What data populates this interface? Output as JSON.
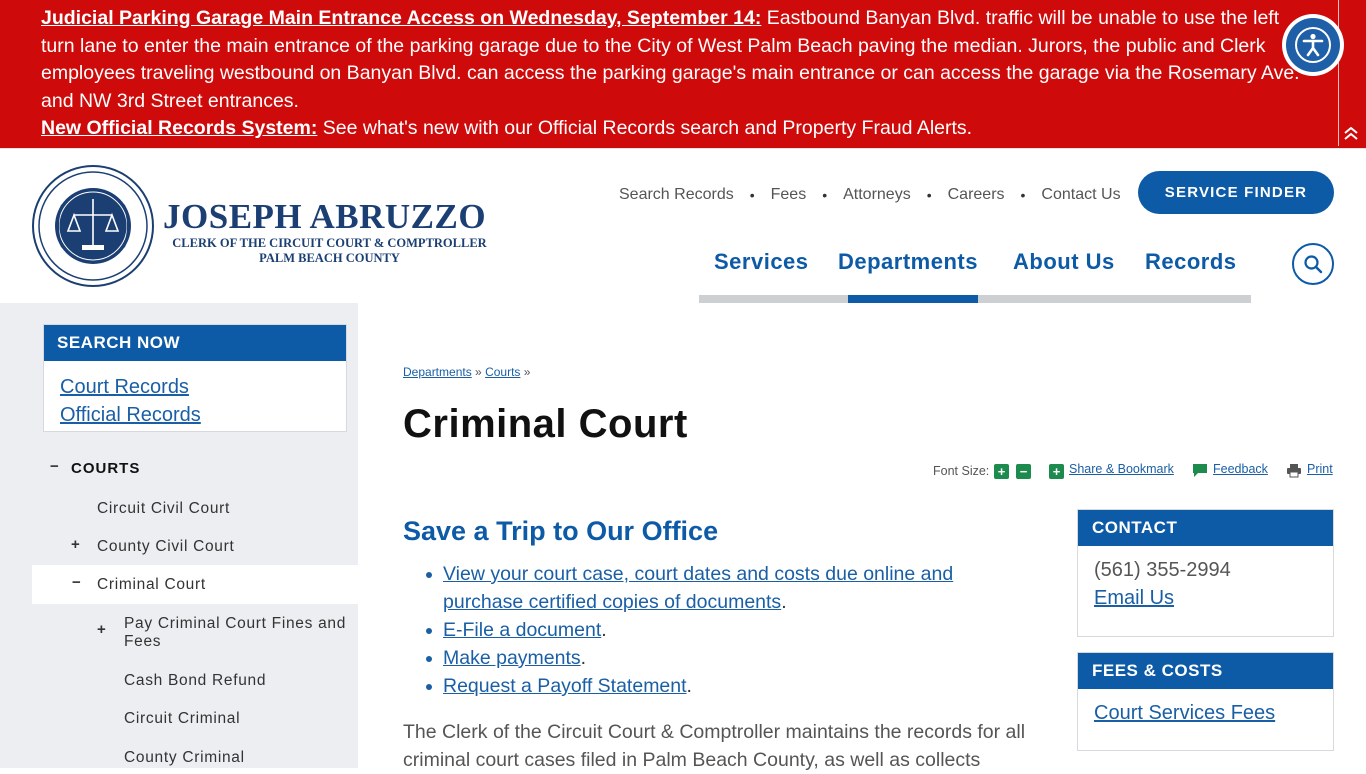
{
  "alert": {
    "item1_title": "Judicial Parking Garage Main Entrance Access on Wednesday, September 14:",
    "item1_body": " Eastbound Banyan Blvd. traffic will be unable to use the left turn lane to enter the main entrance of the parking garage due to the City of West Palm Beach paving the median. Jurors, the public and Clerk employees traveling westbound on Banyan Blvd. can access the parking garage's main entrance or can access the garage via the Rosemary Ave. and NW 3rd Street entrances.",
    "item2_title": "New Official Records System:",
    "item2_body": " See what's new with our Official Records search and Property Fraud Alerts."
  },
  "header": {
    "logo_name": "JOSEPH ABRUZZO",
    "logo_sub1": "CLERK OF THE CIRCUIT COURT & COMPTROLLER",
    "logo_sub2": "PALM BEACH COUNTY",
    "seal_text": "CLERK OF THE CIRCUIT COURT & COMPTROLLER · PALM BEACH COUNTY",
    "util_links": [
      "Search Records",
      "Fees",
      "Attorneys",
      "Careers",
      "Contact Us"
    ],
    "separator": "•",
    "service_finder": "SERVICE FINDER",
    "main_nav": [
      "Services",
      "Departments",
      "About Us",
      "Records"
    ],
    "active_nav": "Departments"
  },
  "sidebar": {
    "search_title": "SEARCH NOW",
    "search_links": [
      "Court Records",
      "Official Records"
    ],
    "section_title": "COURTS",
    "items": [
      {
        "label": "Circuit Civil Court",
        "sign": ""
      },
      {
        "label": "County Civil Court",
        "sign": "+"
      },
      {
        "label": "Criminal Court",
        "sign": "−",
        "active": true
      },
      {
        "label": "Pay Criminal Court Fines and Fees",
        "sign": "+"
      },
      {
        "label": "Cash Bond Refund",
        "sign": ""
      },
      {
        "label": "Circuit Criminal",
        "sign": ""
      },
      {
        "label": "County Criminal",
        "sign": ""
      }
    ],
    "section_sign": "−"
  },
  "content": {
    "breadcrumb": [
      {
        "label": "Departments"
      },
      {
        "label": "Courts"
      }
    ],
    "breadcrumb_sep": "»",
    "title": "Criminal Court",
    "tools": {
      "font_size": "Font Size:",
      "share": "Share & Bookmark",
      "feedback": "Feedback",
      "print": "Print"
    },
    "section_title": "Save a Trip to Our Office",
    "bullets": [
      {
        "link": "View your court case, court dates and costs due online and purchase certified copies of documents",
        "tail": "."
      },
      {
        "link": "E-File a document",
        "tail": "."
      },
      {
        "link": "Make payments",
        "tail": "."
      },
      {
        "link": "Request a Payoff Statement",
        "tail": "."
      }
    ],
    "paragraph": "The Clerk of the Circuit Court & Comptroller maintains the records for all criminal court cases filed in Palm Beach County, as well as collects"
  },
  "right": {
    "contact_title": "CONTACT",
    "phone": "(561) 355-2994",
    "email": "Email Us",
    "fees_title": "FEES & COSTS",
    "fees_link": "Court Services Fees"
  },
  "colors": {
    "alert_red": "#cf0a0a",
    "brand_blue": "#0d5aa7",
    "navy": "#1b3f73",
    "tool_green": "#1d8a4e"
  }
}
